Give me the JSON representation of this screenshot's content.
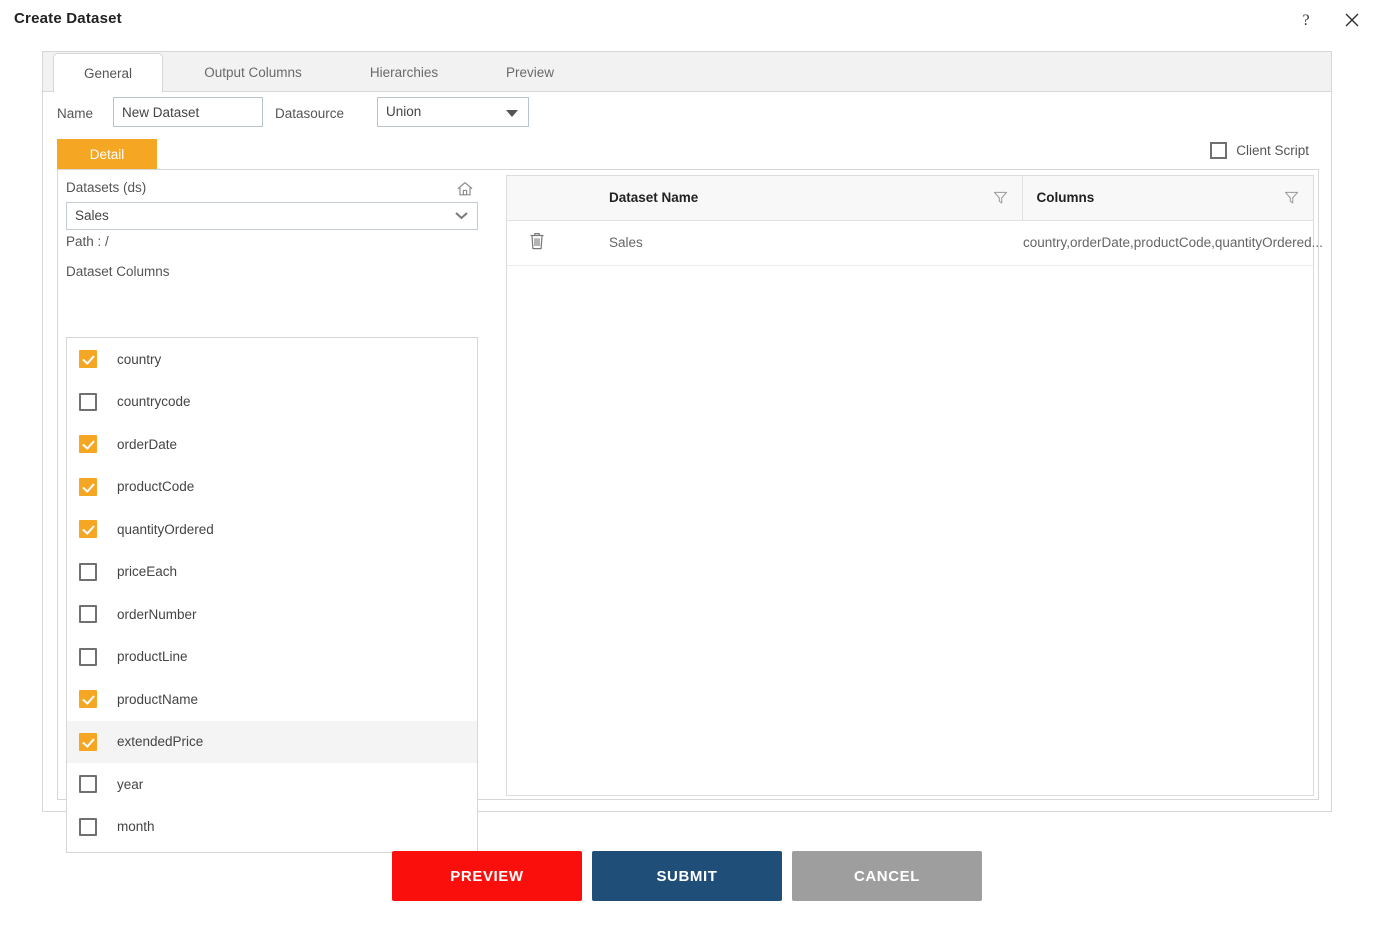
{
  "dialog": {
    "title": "Create Dataset",
    "help_icon": "question-mark-icon",
    "close_icon": "close-icon"
  },
  "tabs": [
    {
      "label": "General",
      "active": true
    },
    {
      "label": "Output Columns",
      "active": false
    },
    {
      "label": "Hierarchies",
      "active": false
    },
    {
      "label": "Preview",
      "active": false
    }
  ],
  "form": {
    "name_label": "Name",
    "name_value": "New Dataset",
    "name_placeholder": "New Dataset",
    "datasource_label": "Datasource",
    "datasource_value": "Union"
  },
  "client_script": {
    "label": "Client Script",
    "checked": false
  },
  "detail_tab": {
    "label": "Detail",
    "color": "#F5A623"
  },
  "left_pane": {
    "datasets_label": "Datasets (ds)",
    "home_icon": "home-icon",
    "dataset_value": "Sales",
    "path_label": "Path :  /",
    "dataset_columns_label": "Dataset Columns",
    "columns": [
      {
        "name": "country",
        "checked": true,
        "selected": false
      },
      {
        "name": "countrycode",
        "checked": false,
        "selected": false
      },
      {
        "name": "orderDate",
        "checked": true,
        "selected": false
      },
      {
        "name": "productCode",
        "checked": true,
        "selected": false
      },
      {
        "name": "quantityOrdered",
        "checked": true,
        "selected": false
      },
      {
        "name": "priceEach",
        "checked": false,
        "selected": false
      },
      {
        "name": "orderNumber",
        "checked": false,
        "selected": false
      },
      {
        "name": "productLine",
        "checked": false,
        "selected": false
      },
      {
        "name": "productName",
        "checked": true,
        "selected": false
      },
      {
        "name": "extendedPrice",
        "checked": true,
        "selected": true
      },
      {
        "name": "year",
        "checked": false,
        "selected": false
      },
      {
        "name": "month",
        "checked": false,
        "selected": false
      }
    ]
  },
  "table": {
    "headers": {
      "action": "",
      "dataset_name": "Dataset Name",
      "columns": "Columns"
    },
    "filter_icon": "funnel-filter-icon",
    "rows": [
      {
        "delete_icon": "trash-icon",
        "dataset_name": "Sales",
        "columns": "country,orderDate,productCode,quantityOrdered..."
      }
    ]
  },
  "footer": {
    "preview_label": "PREVIEW",
    "submit_label": "SUBMIT",
    "cancel_label": "CANCEL",
    "preview_color": "#FA0F0C",
    "submit_color": "#1F4E79",
    "cancel_color": "#9E9E9E"
  }
}
